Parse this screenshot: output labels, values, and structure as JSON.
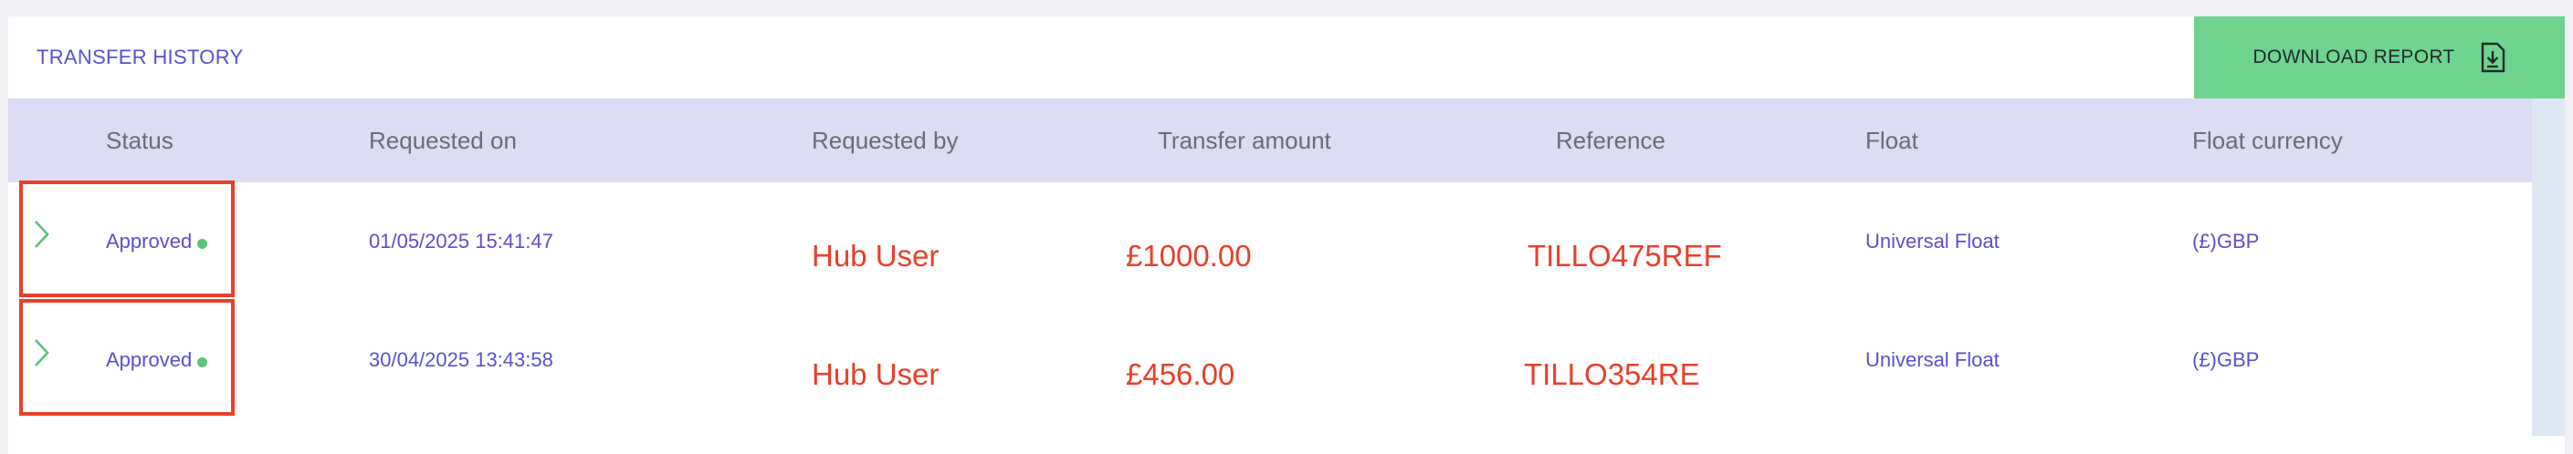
{
  "panel": {
    "title": "TRANSFER HISTORY",
    "download_label": "DOWNLOAD REPORT"
  },
  "colors": {
    "accent": "#5a4fcf",
    "download_bg": "#6fd48e",
    "header_bg": "#dcdcf4",
    "highlight": "#e8402a",
    "approved_dot": "#5ac47a"
  },
  "icons": {
    "download": "download-icon",
    "expand": "chevron-right-icon"
  },
  "table": {
    "headers": [
      "Status",
      "Requested on",
      "Requested by",
      "Transfer amount",
      "Reference",
      "Float",
      "Float currency"
    ],
    "rows": [
      {
        "status": "Approved",
        "requested_on": "01/05/2025 15:41:47",
        "requested_by": "Hub User",
        "amount": "£1000.00",
        "reference": "TILLO475REF",
        "float": "Universal Float",
        "currency": "(£)GBP"
      },
      {
        "status": "Approved",
        "requested_on": "30/04/2025 13:43:58",
        "requested_by": "Hub User",
        "amount": "£456.00",
        "reference": "TILLO354RE",
        "float": "Universal Float",
        "currency": "(£)GBP"
      }
    ]
  }
}
